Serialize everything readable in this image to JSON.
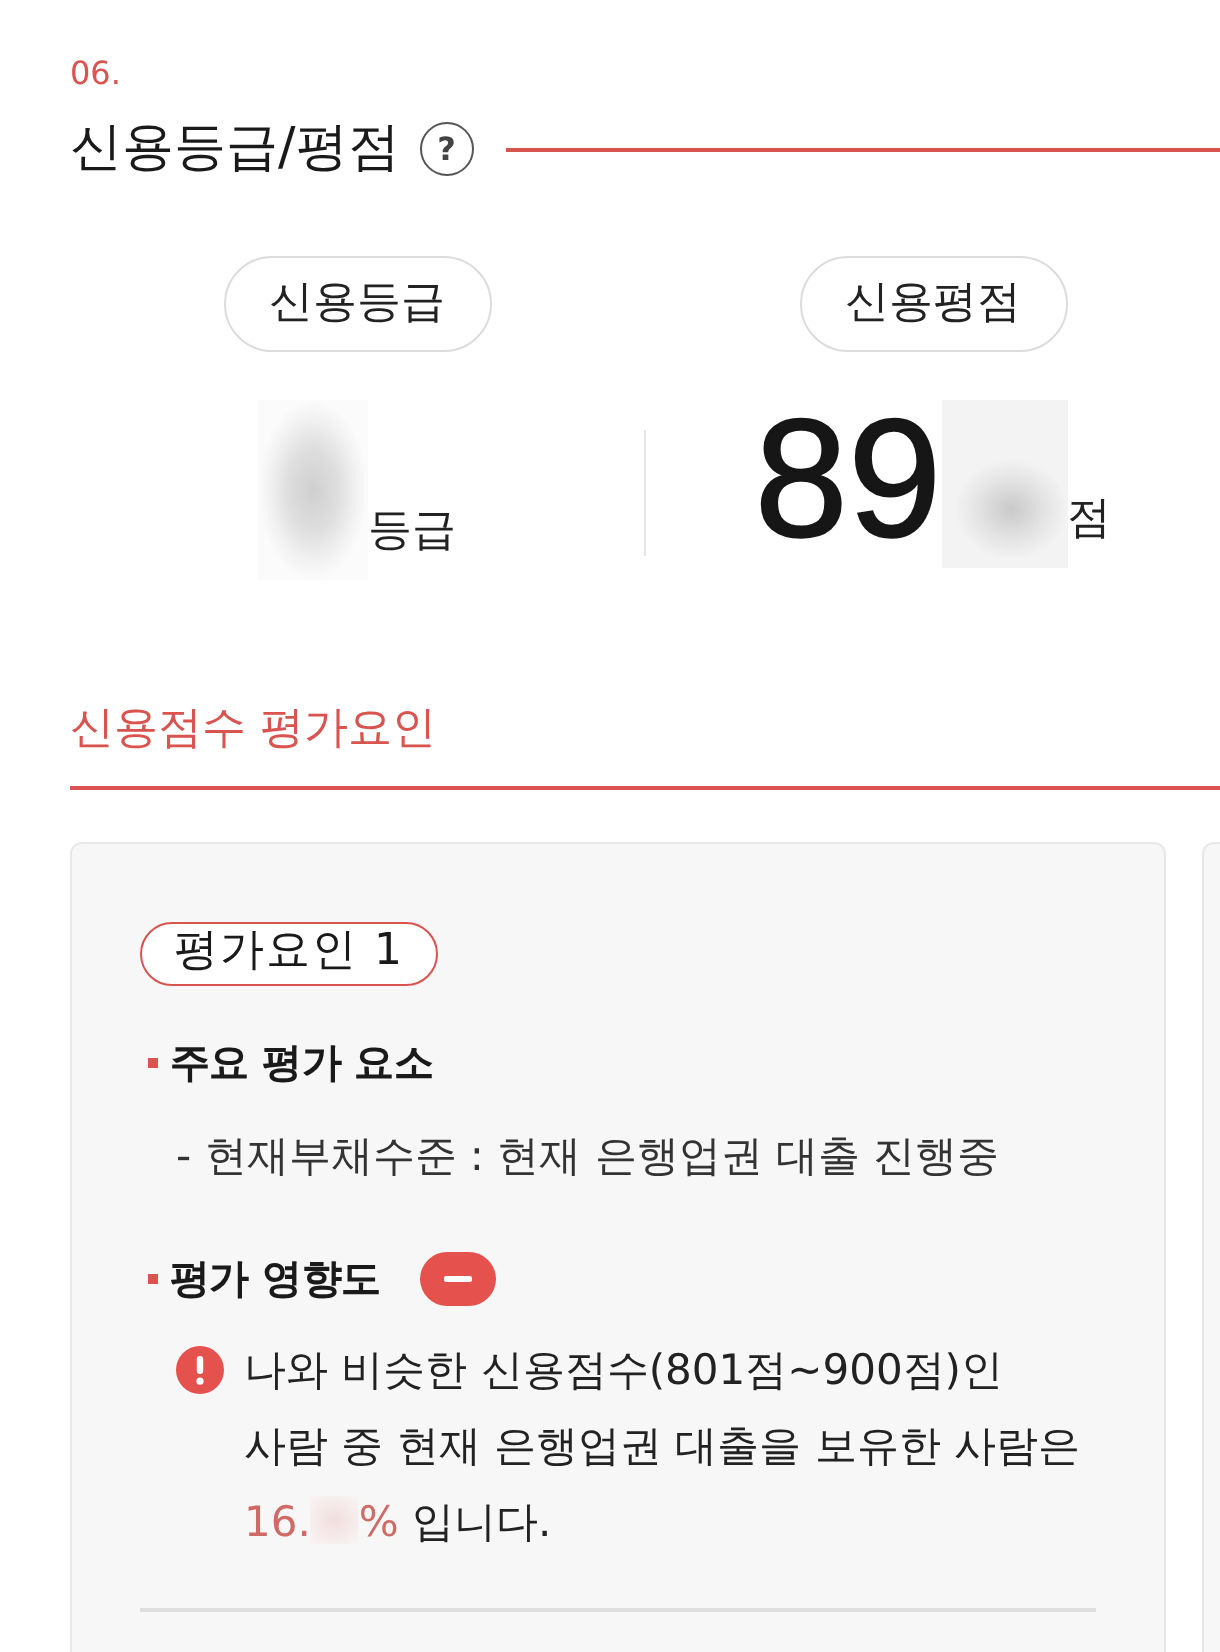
{
  "section": {
    "number": "06.",
    "title": "신용등급/평점",
    "help": "?"
  },
  "summary": [
    {
      "kind": "grade",
      "label": "신용등급",
      "value_redacted": true,
      "unit": "등급"
    },
    {
      "kind": "score",
      "label": "신용평점",
      "value": "89",
      "value_redacted": true,
      "unit": "점"
    }
  ],
  "factors_title": "신용점수 평가요인",
  "factors": [
    {
      "tag": "평가요인 1",
      "element_heading": "주요 평가 요소",
      "element_detail": "- 현재부채수준 : 현재 은행업권 대출 진행중",
      "impact_heading": "평가 영향도",
      "impact_badge": {
        "kind": "minus"
      },
      "note_lines": [
        [
          {
            "kind": "text",
            "text": "나와 비슷한 신용점수(801점~900점)인"
          }
        ],
        [
          {
            "kind": "text",
            "text": "사람 중 현재 은행업권 대출을 보유한 사람은"
          }
        ],
        [
          {
            "kind": "highlight",
            "text": "16."
          },
          {
            "kind": "redacted"
          },
          {
            "kind": "highlight",
            "text": "%"
          },
          {
            "kind": "text",
            "text": " 입니다."
          }
        ]
      ]
    }
  ]
}
